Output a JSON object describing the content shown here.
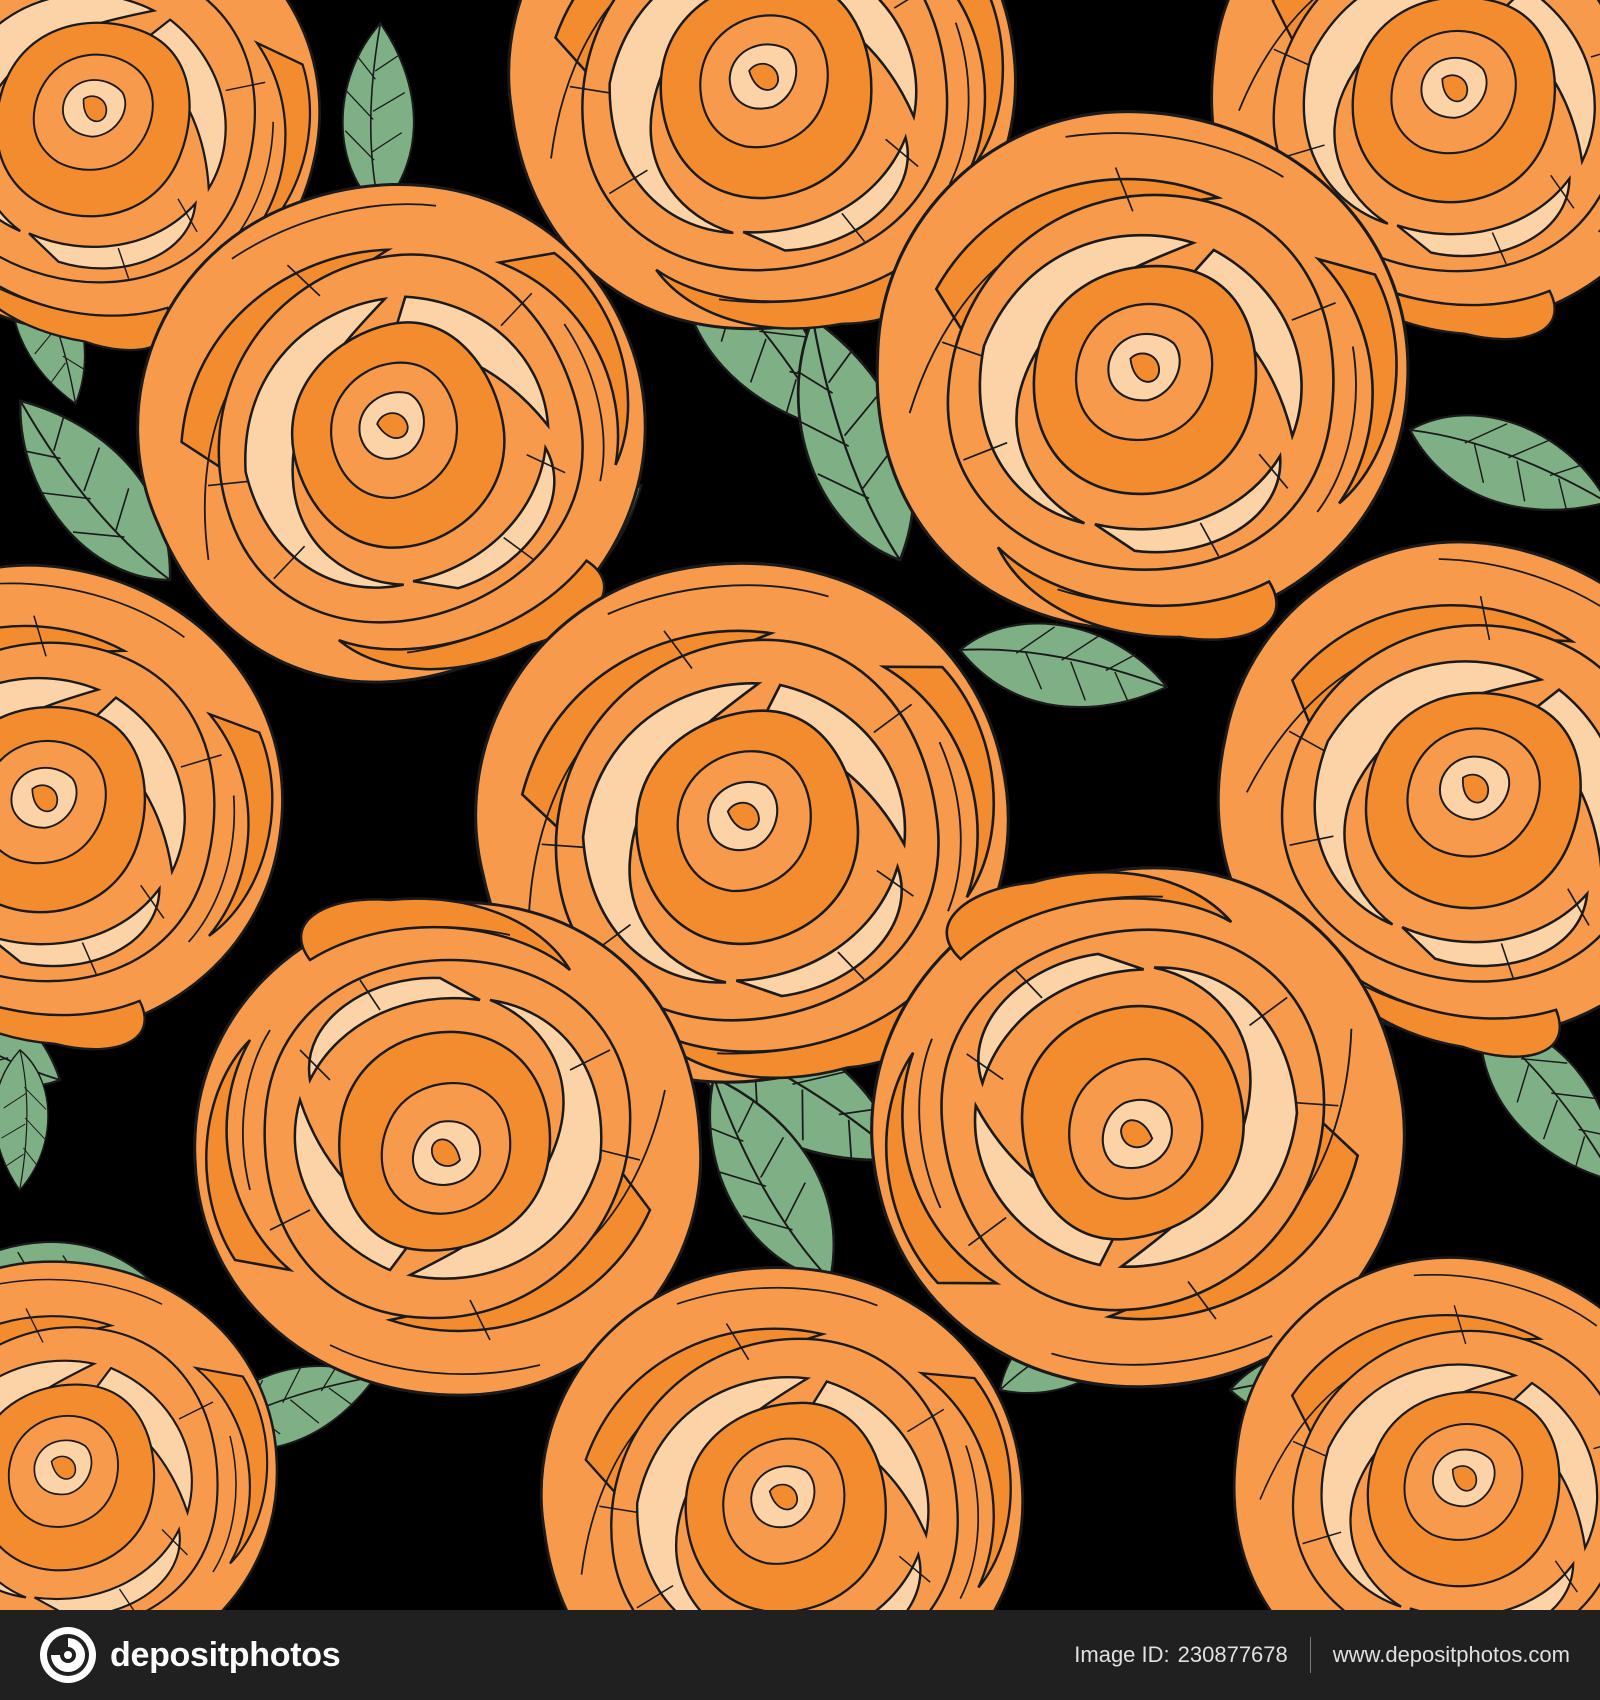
{
  "footer": {
    "brand": "depositphotos",
    "image_id_label": "Image ID:",
    "image_id": "230877678",
    "site_url": "www.depositphotos.com"
  },
  "colors": {
    "background": "#000000",
    "rose_outer": "#F79A4C",
    "rose_mid": "#F28C2F",
    "rose_light": "#FBD3A6",
    "leaf": "#7FAF85",
    "outline": "#1a1a1a",
    "footer_bg": "#202020"
  }
}
